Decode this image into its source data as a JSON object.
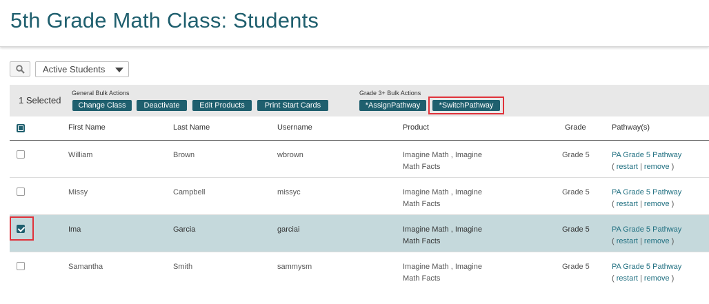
{
  "page": {
    "title": "5th Grade Math Class: Students"
  },
  "toolbar": {
    "search_icon": "search-icon",
    "filter_value": "Active Students"
  },
  "bulk": {
    "selected_label": "1 Selected",
    "general_label": "General Bulk Actions",
    "grade_label": "Grade 3+ Bulk Actions",
    "buttons": {
      "change_class": "Change Class",
      "deactivate": "Deactivate",
      "edit_products": "Edit Products",
      "print_start_cards": "Print Start Cards",
      "assign_pathway": "*AssignPathway",
      "switch_pathway": "*SwitchPathway"
    }
  },
  "table": {
    "columns": {
      "first": "First Name",
      "last": "Last Name",
      "username": "Username",
      "product": "Product",
      "grade": "Grade",
      "pathway": "Pathway(s)"
    },
    "rows": [
      {
        "checked": false,
        "first": "William",
        "last": "Brown",
        "username": "wbrown",
        "product_line1": "Imagine Math , Imagine",
        "product_line2": "Math Facts",
        "grade": "Grade 5",
        "pathway": "PA Grade 5 Pathway",
        "restart": "restart",
        "remove": "remove"
      },
      {
        "checked": false,
        "first": "Missy",
        "last": "Campbell",
        "username": "missyc",
        "product_line1": "Imagine Math , Imagine",
        "product_line2": "Math Facts",
        "grade": "Grade 5",
        "pathway": "PA Grade 5 Pathway",
        "restart": "restart",
        "remove": "remove"
      },
      {
        "checked": true,
        "first": "Ima",
        "last": "Garcia",
        "username": "garciai",
        "product_line1": "Imagine Math , Imagine",
        "product_line2": "Math Facts",
        "grade": "Grade 5",
        "pathway": "PA Grade 5 Pathway",
        "restart": "restart",
        "remove": "remove"
      },
      {
        "checked": false,
        "first": "Samantha",
        "last": "Smith",
        "username": "sammysm",
        "product_line1": "Imagine Math , Imagine",
        "product_line2": "Math Facts",
        "grade": "Grade 5",
        "pathway": "PA Grade 5 Pathway",
        "restart": "restart",
        "remove": "remove"
      }
    ]
  },
  "colors": {
    "primary": "#1f5f6e",
    "highlight": "#e0323a",
    "selected_row": "#c5d9dc"
  }
}
